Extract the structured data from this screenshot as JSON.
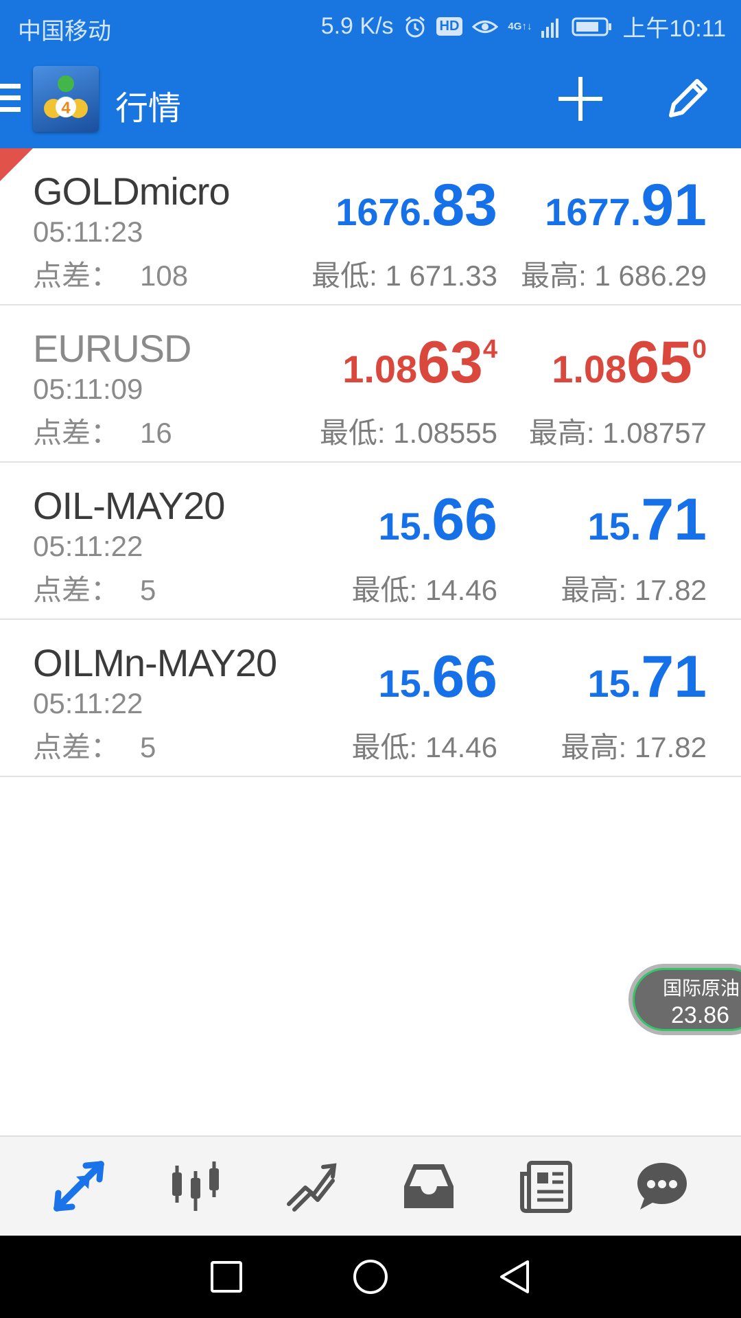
{
  "status_bar": {
    "carrier": "中国移动",
    "net_speed": "5.9 K/s",
    "hd_badge": "HD",
    "net_type_top": "4G",
    "net_type_bottom": "↑↓",
    "time": "上午10:11",
    "icons": [
      "alarm-icon",
      "hd-icon",
      "eye-icon",
      "signal-icon",
      "battery-icon"
    ]
  },
  "app_bar": {
    "title": "行情",
    "icons": [
      "menu-icon",
      "metatrader-logo",
      "add-icon",
      "edit-icon"
    ]
  },
  "quotes": [
    {
      "symbol": "GOLDmicro",
      "time": "05:11:23",
      "spread_label": "点差：",
      "spread": "108",
      "bid_small": "1676.",
      "bid_big": "83",
      "bid_sup": "",
      "ask_small": "1677.",
      "ask_big": "91",
      "ask_sup": "",
      "low": "最低: 1 671.33",
      "high": "最高: 1 686.29",
      "color": "#1670e8",
      "flagged": true
    },
    {
      "symbol": "EURUSD",
      "time": "05:11:09",
      "spread_label": "点差：",
      "spread": "16",
      "bid_small": "1.08",
      "bid_big": "63",
      "bid_sup": "4",
      "ask_small": "1.08",
      "ask_big": "65",
      "ask_sup": "0",
      "low": "最低: 1.08555",
      "high": "最高: 1.08757",
      "color": "#d9473d",
      "flagged": false
    },
    {
      "symbol": "OIL-MAY20",
      "time": "05:11:22",
      "spread_label": "点差：",
      "spread": "5",
      "bid_small": "15.",
      "bid_big": "66",
      "bid_sup": "",
      "ask_small": "15.",
      "ask_big": "71",
      "ask_sup": "",
      "low": "最低: 14.46",
      "high": "最高: 17.82",
      "color": "#1670e8",
      "flagged": false
    },
    {
      "symbol": "OILMn-MAY20",
      "time": "05:11:22",
      "spread_label": "点差：",
      "spread": "5",
      "bid_small": "15.",
      "bid_big": "66",
      "bid_sup": "",
      "ask_small": "15.",
      "ask_big": "71",
      "ask_sup": "",
      "low": "最低: 14.46",
      "high": "最高: 17.82",
      "color": "#1670e8",
      "flagged": false
    }
  ],
  "floating_widget": {
    "label": "国际原油",
    "value": "23.86"
  },
  "bottom_nav": {
    "items": [
      "quotes-icon",
      "chart-icon",
      "trade-icon",
      "history-icon",
      "news-icon",
      "chat-icon"
    ],
    "active_color": "#1a73e8",
    "inactive_color": "#555555"
  },
  "system_nav": {
    "items": [
      "recents-icon",
      "home-icon",
      "back-icon"
    ]
  }
}
